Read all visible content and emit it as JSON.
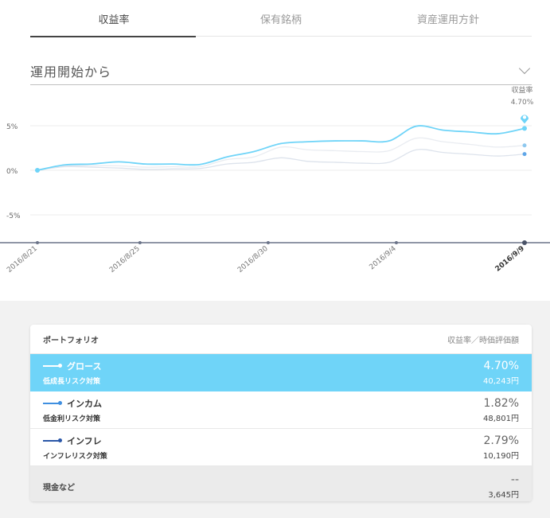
{
  "tabs": [
    {
      "label": "収益率",
      "active": true
    },
    {
      "label": "保有銘柄",
      "active": false
    },
    {
      "label": "資産運用方針",
      "active": false
    }
  ],
  "period": {
    "value": "運用開始から"
  },
  "chart_data": {
    "type": "line",
    "x_ticks": [
      "2016/8/21",
      "2016/8/25",
      "2016/8/30",
      "2016/9/4",
      "2016/9/9"
    ],
    "x_range": [
      "2016/8/21",
      "2016/9/9"
    ],
    "y_ticks": [
      "5%",
      "0%",
      "-5%"
    ],
    "ylim": [
      -8,
      8
    ],
    "callout": {
      "label": "収益率",
      "value": "4.70%"
    },
    "series": [
      {
        "name": "グロース",
        "color": "#6fd4f8",
        "values": [
          0.0,
          0.6,
          0.7,
          0.95,
          0.7,
          0.7,
          0.65,
          1.5,
          2.1,
          3.0,
          3.2,
          3.3,
          3.3,
          3.3,
          4.95,
          4.5,
          4.3,
          4.1,
          4.7
        ]
      },
      {
        "name": "インカム",
        "color": "#dde3ec",
        "values": [
          0.0,
          0.4,
          0.35,
          0.25,
          0.1,
          0.15,
          0.2,
          0.7,
          0.9,
          1.4,
          1.0,
          0.9,
          0.8,
          0.9,
          2.3,
          2.0,
          1.8,
          1.6,
          1.82
        ]
      },
      {
        "name": "インフレ",
        "color": "#e9ecf1",
        "values": [
          0.0,
          0.5,
          0.5,
          0.5,
          0.35,
          0.4,
          0.4,
          1.2,
          1.5,
          2.6,
          2.3,
          2.2,
          2.1,
          2.2,
          3.6,
          3.2,
          2.9,
          2.6,
          2.79
        ]
      }
    ]
  },
  "portfolio": {
    "header_left": "ポートフォリオ",
    "header_right": "収益率／時価評価額",
    "items": [
      {
        "name": "グロース",
        "sub": "低成長リスク対策",
        "pct": "4.70%",
        "amount": "40,243円",
        "swatch": "#ffffff"
      },
      {
        "name": "インカム",
        "sub": "低金利リスク対策",
        "pct": "1.82%",
        "amount": "48,801円",
        "swatch": "#3f8fe0"
      },
      {
        "name": "インフレ",
        "sub": "インフレリスク対策",
        "pct": "2.79%",
        "amount": "10,190円",
        "swatch": "#2a57a8"
      }
    ],
    "cash": {
      "label": "現金など",
      "pct": "--",
      "amount": "3,645円"
    }
  }
}
